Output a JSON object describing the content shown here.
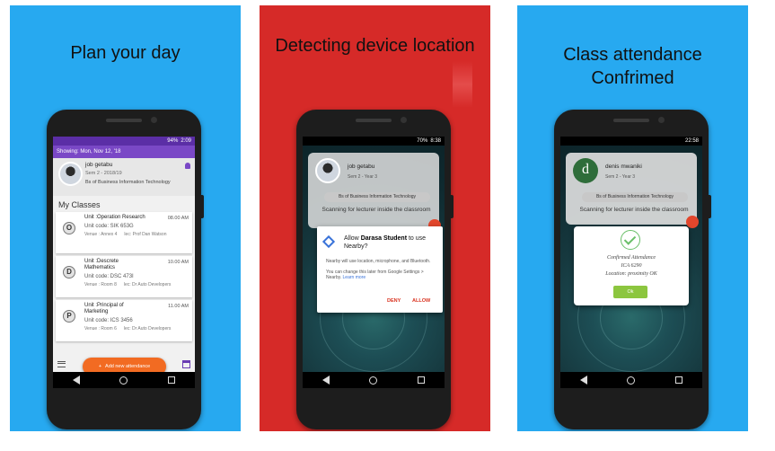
{
  "panels": [
    {
      "caption_line1": "Plan your day",
      "caption_line2": "",
      "status": {
        "battery": "94%",
        "time": "2:09"
      },
      "showing": "Showing: Mon, Nov 12, '18",
      "profile": {
        "name": "job getabu",
        "sem": "Sem 2 - 2018/19",
        "program": "Bs of Business Information Technology"
      },
      "section_title": "My Classes",
      "classes": [
        {
          "letter": "O",
          "unit": "Unit :Operation Research",
          "time": "08.00 AM",
          "code": "Unit code: SIK 653G",
          "venue": "Venue : Annex 4",
          "lec": "lec: Prof Dan Watson"
        },
        {
          "letter": "D",
          "unit": "Unit :Descrete Mathematics",
          "time": "10.00 AM",
          "code": "Unit code: DSC 473I",
          "venue": "Venue : Room 8",
          "lec": "lec: Dr Auto Developers"
        },
        {
          "letter": "P",
          "unit": "Unit :Principal of Marketing",
          "time": "11.00 AM",
          "code": "Unit code: ICS 3456",
          "venue": "Venue : Room 6",
          "lec": "lec: Dr Auto Developers"
        }
      ],
      "fab_label": "Add new attendance"
    },
    {
      "caption_line1": "Detecting device location",
      "status": {
        "battery": "70%",
        "time": "8:38"
      },
      "profile": {
        "name": "job getabu",
        "sem": "Sem 2 - Year 3",
        "program": "Bs of Business Information Technology"
      },
      "scanning": "Scanning for lecturer inside the classroom",
      "dialog": {
        "title_pre": "Allow ",
        "title_app": "Darasa Student",
        "title_post": " to use Nearby?",
        "body1": "Nearby will use location, microphone, and Bluetooth.",
        "body2": "You can change this later from Google Settings > Nearby.",
        "learn_more": "Learn more",
        "deny": "DENY",
        "allow": "ALLOW"
      }
    },
    {
      "caption_line1": "Class attendance",
      "caption_line2": "Confrimed",
      "status": {
        "time": "22:58"
      },
      "profile": {
        "letter": "d",
        "name": "denis mwaniki",
        "sem": "Sem 2 - Year 3",
        "program": "Bs of Business Information Technology"
      },
      "scanning": "Scanning for lecturer inside the classroom",
      "confirm": {
        "line1": "Confirmed Attendance",
        "line2": "ICA 6290",
        "line3": "Location: proximity OK",
        "ok": "Ok"
      }
    }
  ],
  "colors": {
    "panel_blue": "#27a9f0",
    "panel_red": "#d62a28",
    "accent_orange": "#f26b22",
    "purple": "#5b2ea6"
  }
}
